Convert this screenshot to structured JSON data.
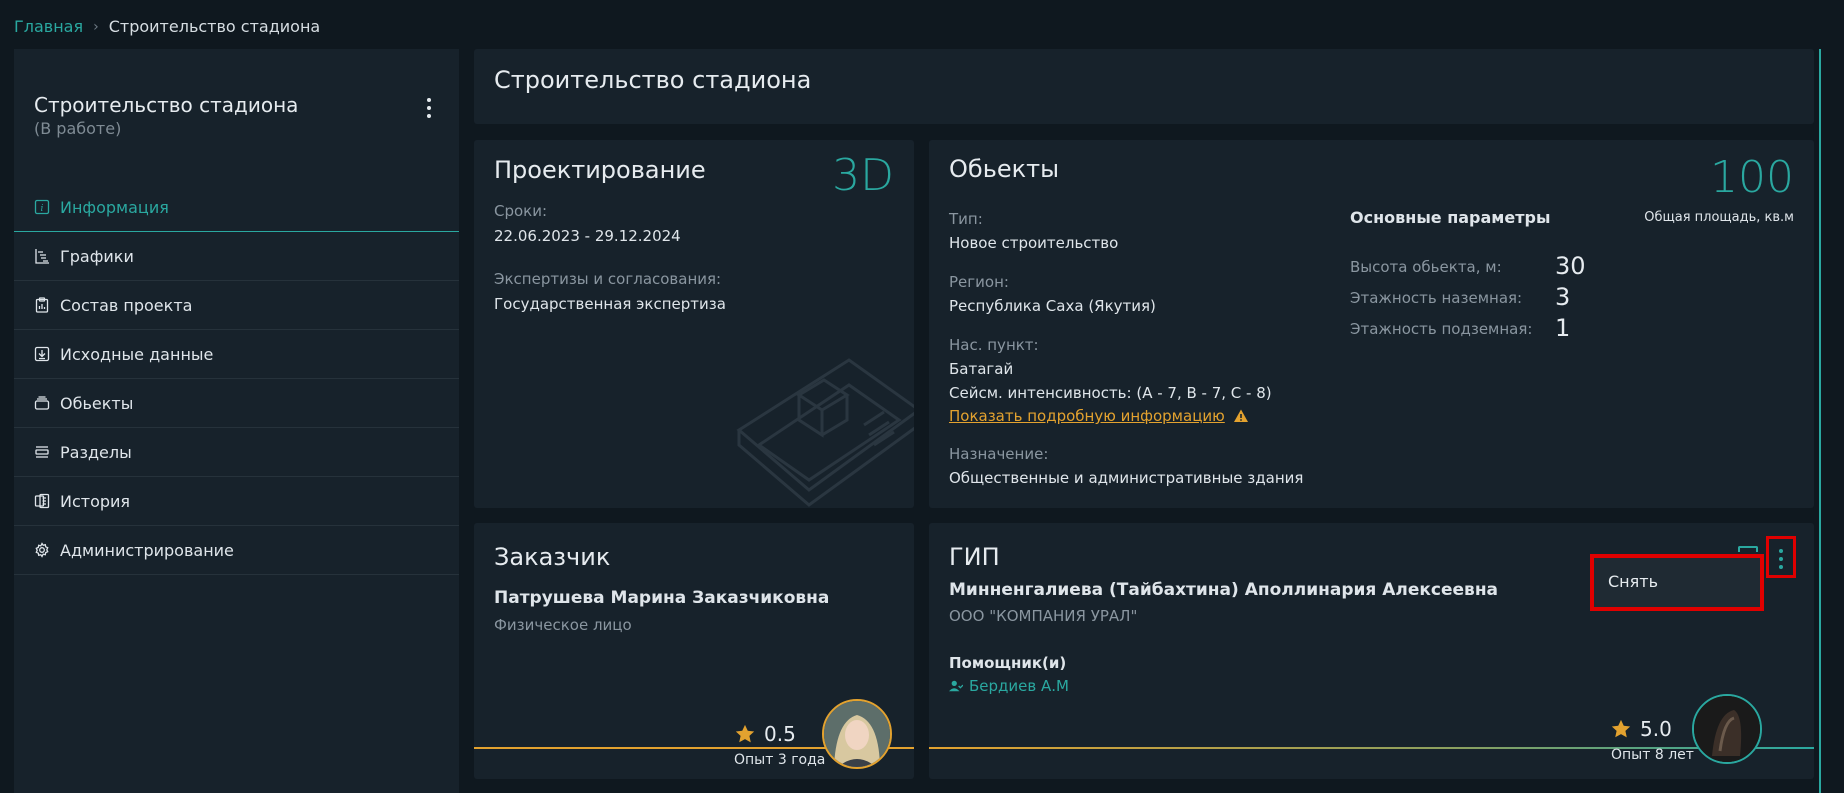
{
  "breadcrumb": {
    "home": "Главная",
    "separator": "›",
    "current": "Строительство стадиона"
  },
  "sidebar": {
    "title": "Строительство стадиона",
    "status": "(В работе)",
    "items": [
      {
        "label": "Информация",
        "icon": "info-icon",
        "active": true
      },
      {
        "label": "Графики",
        "icon": "gantt-icon"
      },
      {
        "label": "Состав проекта",
        "icon": "clipboard-icon"
      },
      {
        "label": "Исходные данные",
        "icon": "download-icon"
      },
      {
        "label": "Обьекты",
        "icon": "layers-icon"
      },
      {
        "label": "Разделы",
        "icon": "sections-icon"
      },
      {
        "label": "История",
        "icon": "history-icon"
      },
      {
        "label": "Администрирование",
        "icon": "gear-icon"
      }
    ]
  },
  "header": {
    "title": "Строительство стадиона"
  },
  "design": {
    "title": "Проектирование",
    "badge": "3D",
    "deadline_label": "Сроки:",
    "deadline_value": "22.06.2023 - 29.12.2024",
    "expertise_label": "Экспертизы и согласования:",
    "expertise_value": "Государственная экспертиза"
  },
  "objects": {
    "title": "Обьекты",
    "area_value": "100",
    "area_label": "Общая площадь, кв.м",
    "type_label": "Тип:",
    "type_value": "Новое строительство",
    "region_label": "Регион:",
    "region_value": "Республика Саха (Якутия)",
    "settlement_label": "Нас. пункт:",
    "settlement_value": "Батагай",
    "seismic_value": "Сейсм. интенсивность: (A - 7, B - 7, C - 8)",
    "details_link": "Показать подробную информацию",
    "purpose_label": "Назначение:",
    "purpose_value": "Общественные и административные здания",
    "params_title": "Основные параметры",
    "params": [
      {
        "label": "Высота обьекта, м:",
        "value": "30"
      },
      {
        "label": "Этажность наземная:",
        "value": "3"
      },
      {
        "label": "Этажность подземная:",
        "value": "1"
      }
    ]
  },
  "customer": {
    "title": "Заказчик",
    "name": "Патрушева Марина Заказчиковна",
    "type": "Физическое лицо",
    "rating": "0.5",
    "experience": "Опыт 3 года"
  },
  "gip": {
    "title": "ГИП",
    "name": "Минненгалиева (Тайбахтина) Аполлинария Алексеевна",
    "company": "ООО \"КОМПАНИЯ УРАЛ\"",
    "assistants_label": "Помощник(и)",
    "assistant": "Бердиев А.М",
    "rating": "5.0",
    "experience": "Опыт 8 лет",
    "menu_item": "Снять"
  },
  "colors": {
    "accent": "#2aa8a0",
    "warning": "#e3a22f",
    "highlight": "#e00000"
  }
}
